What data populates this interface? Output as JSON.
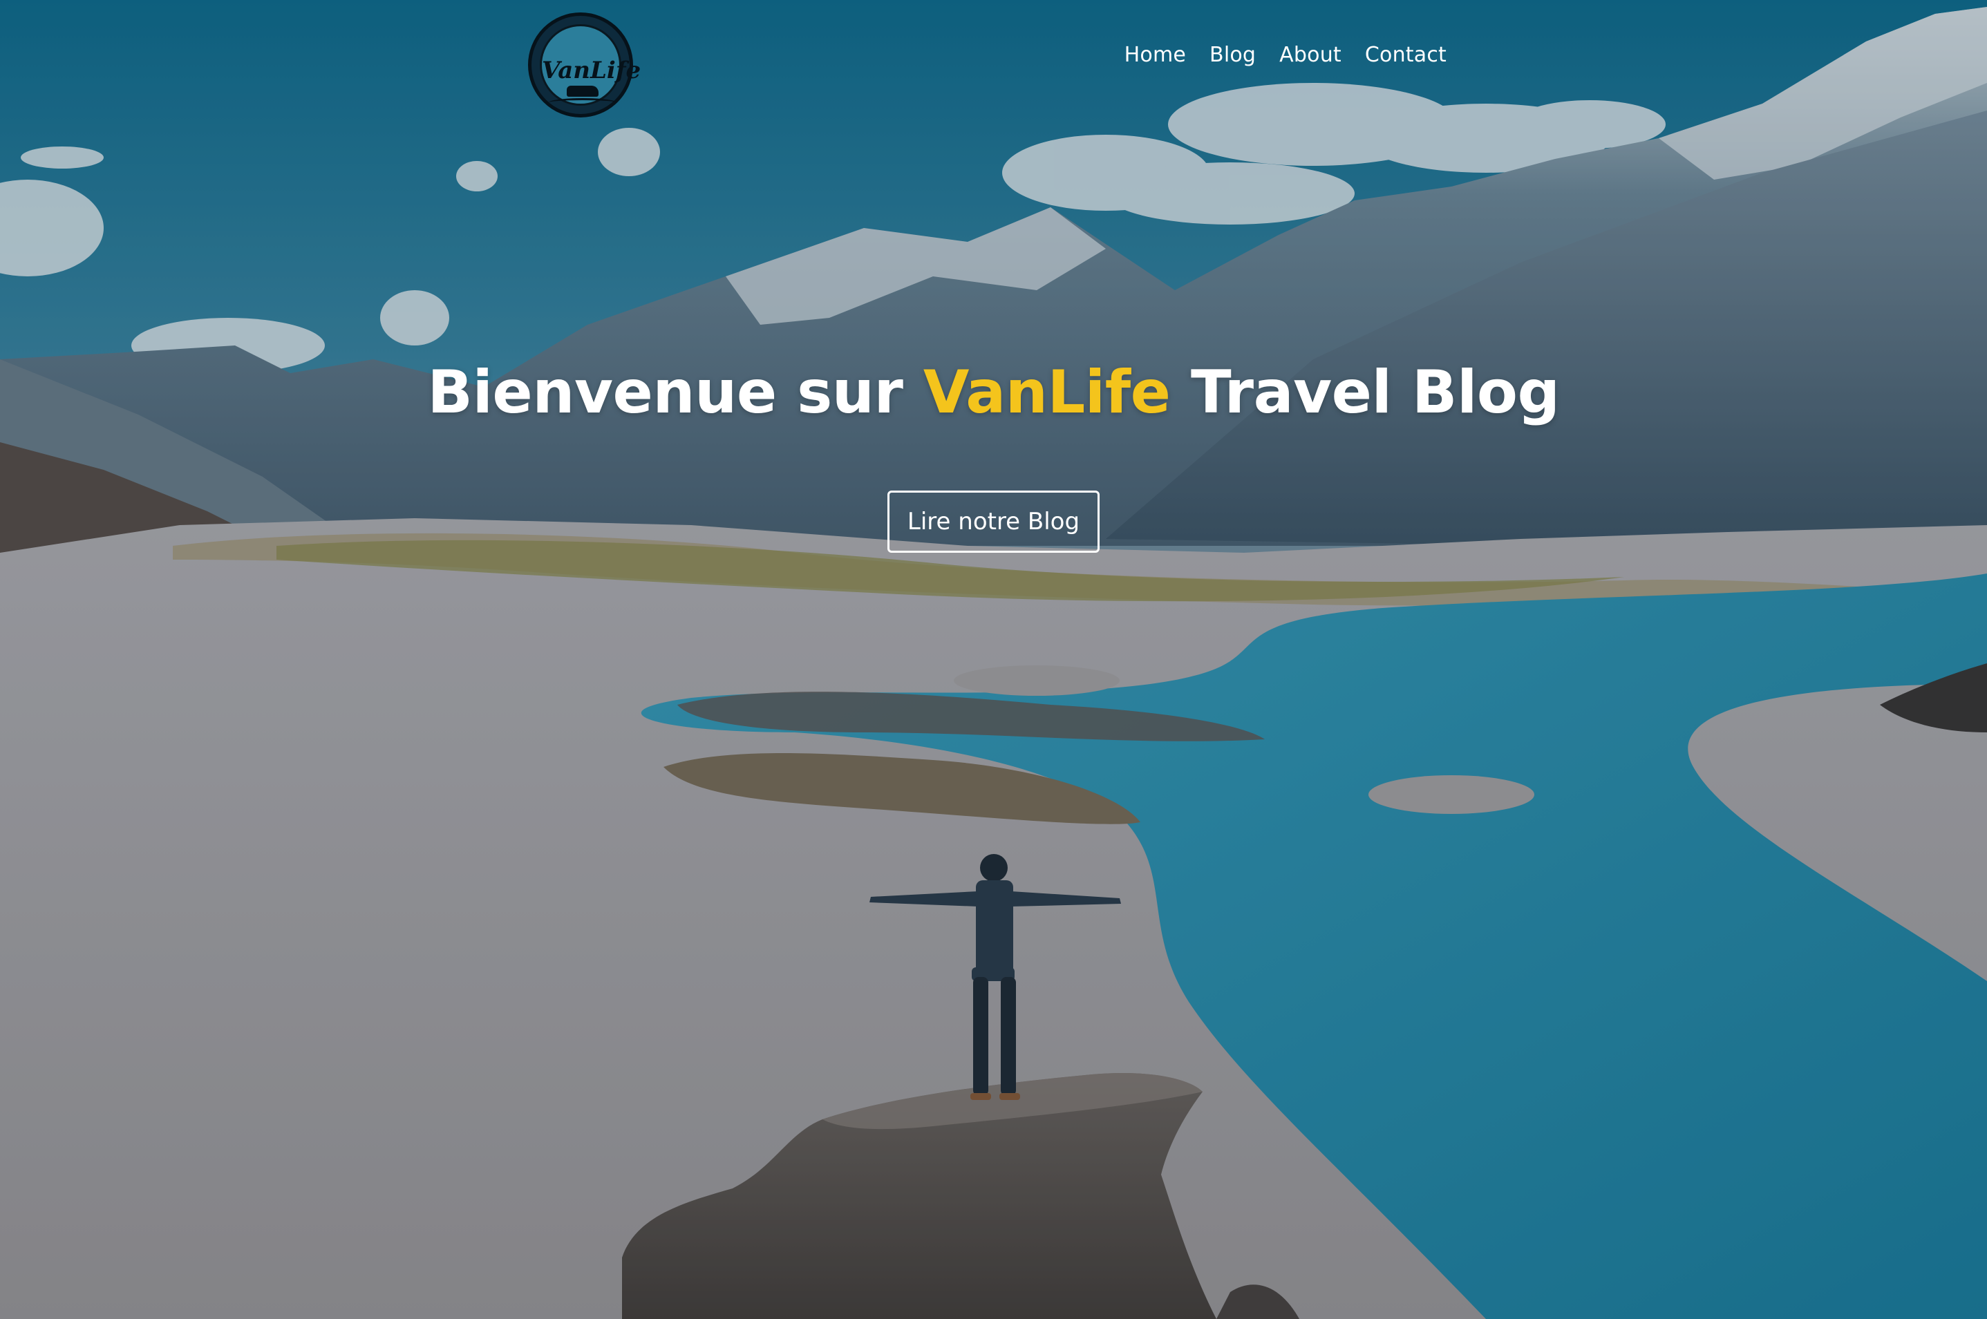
{
  "brand": {
    "logo_text": "VanLife",
    "logo_icon": "vanlife-logo"
  },
  "nav": {
    "items": [
      {
        "label": "Home"
      },
      {
        "label": "Blog"
      },
      {
        "label": "About"
      },
      {
        "label": "Contact"
      }
    ]
  },
  "hero": {
    "headline_prefix": "Bienvenue sur ",
    "headline_accent": "VanLife",
    "headline_suffix": " Travel Blog",
    "cta_label": "Lire notre Blog",
    "accent_color": "#f4c41c",
    "background_scene": "mountain-river-valley-photo"
  }
}
